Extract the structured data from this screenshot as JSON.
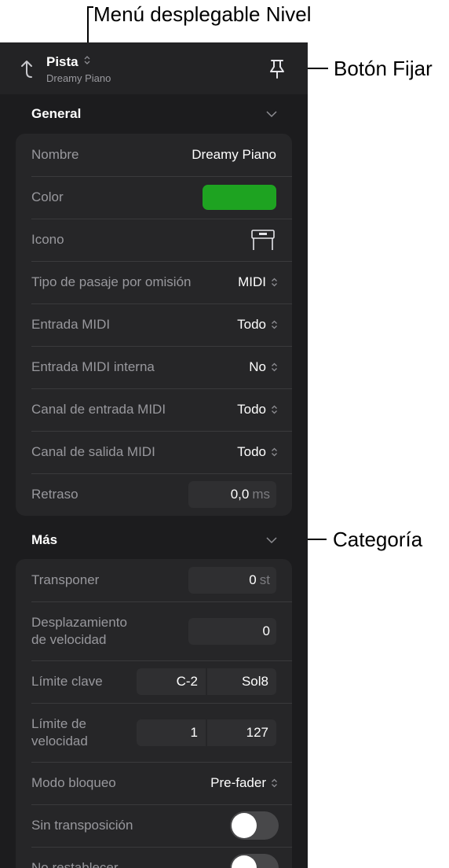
{
  "annotations": {
    "level_menu": "Menú desplegable Nivel",
    "pin_button": "Botón Fijar",
    "category": "Categoría"
  },
  "header": {
    "title": "Pista",
    "subtitle": "Dreamy Piano",
    "icons": {
      "back": "up-arrow-back-icon",
      "pin": "pin-icon",
      "title_popup": "up-down-chevron-icon"
    }
  },
  "general": {
    "title": "General",
    "rows": {
      "name": {
        "label": "Nombre",
        "value": "Dreamy Piano"
      },
      "color": {
        "label": "Color",
        "value": "#1ea321"
      },
      "icon": {
        "label": "Icono",
        "icon": "keyboard-instrument-icon"
      },
      "default_region": {
        "label": "Tipo de pasaje por omisión",
        "value": "MIDI"
      },
      "midi_in": {
        "label": "Entrada MIDI",
        "value": "Todo"
      },
      "midi_in_internal": {
        "label": "Entrada MIDI interna",
        "value": "No"
      },
      "midi_in_channel": {
        "label": "Canal de entrada MIDI",
        "value": "Todo"
      },
      "midi_out_channel": {
        "label": "Canal de salida MIDI",
        "value": "Todo"
      },
      "delay": {
        "label": "Retraso",
        "value": "0,0",
        "unit": "ms"
      }
    }
  },
  "more": {
    "title": "Más",
    "rows": {
      "transpose": {
        "label": "Transponer",
        "value": "0",
        "unit": "st"
      },
      "velocity_offset": {
        "label_1": "Desplazamiento",
        "label_2": "de velocidad",
        "value": "0"
      },
      "key_limit": {
        "label": "Límite clave",
        "low": "C-2",
        "high": "Sol8"
      },
      "velocity_limit": {
        "label_1": "Límite de",
        "label_2": "velocidad",
        "low": "1",
        "high": "127"
      },
      "freeze_mode": {
        "label": "Modo bloqueo",
        "value": "Pre-fader"
      },
      "no_transpose": {
        "label": "Sin transposición",
        "on": false
      },
      "no_reset": {
        "label": "No restablecer",
        "on": false
      }
    }
  },
  "colors": {
    "panel": "#1c1c1e",
    "group": "#262628",
    "accent_green": "#1ea321"
  }
}
